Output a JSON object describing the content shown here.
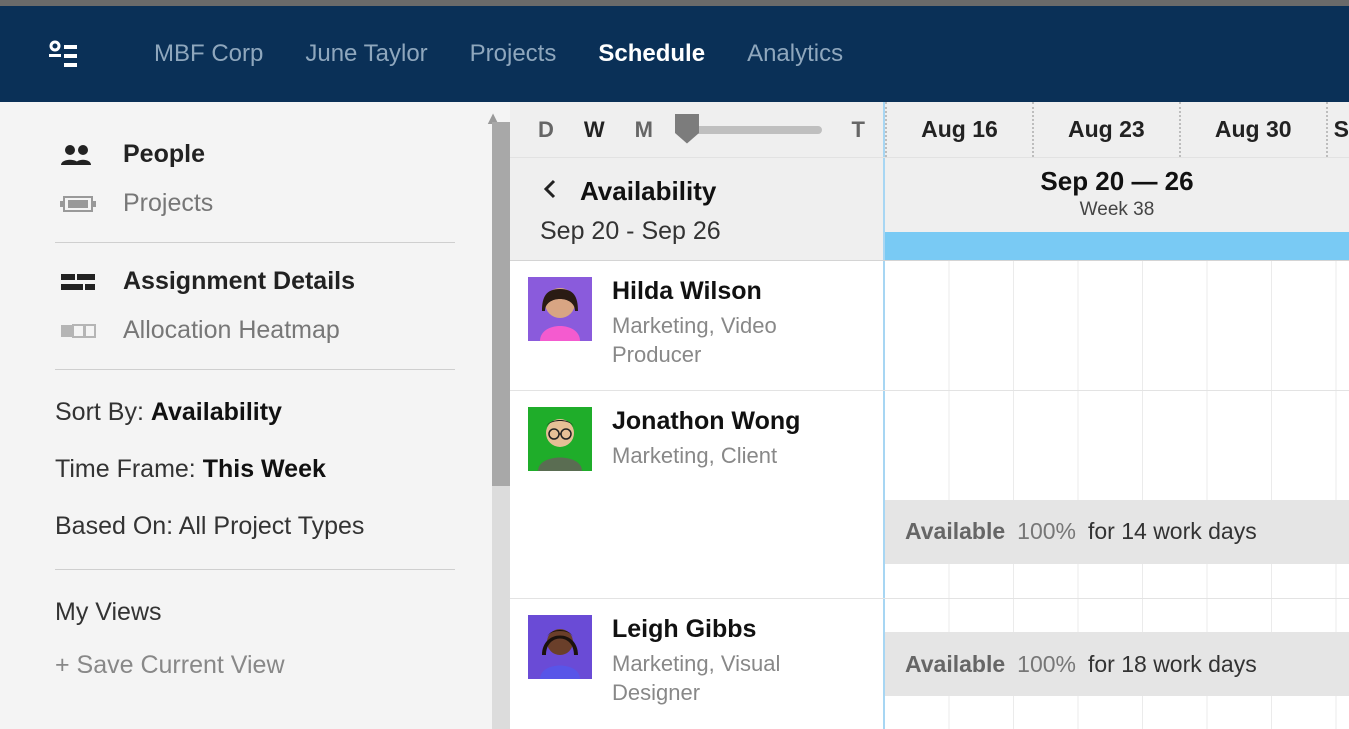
{
  "topnav": {
    "items": [
      {
        "label": "MBF Corp"
      },
      {
        "label": "June Taylor"
      },
      {
        "label": "Projects"
      },
      {
        "label": "Schedule"
      },
      {
        "label": "Analytics"
      }
    ]
  },
  "sidebar": {
    "people": "People",
    "projects": "Projects",
    "assignment_details": "Assignment Details",
    "allocation_heatmap": "Allocation Heatmap",
    "sort_by": {
      "k": "Sort By: ",
      "v": "Availability"
    },
    "time_frame": {
      "k": "Time Frame: ",
      "v": "This Week"
    },
    "based_on": "Based On: All Project Types",
    "my_views": "My Views",
    "save_current_view": "+ Save Current View"
  },
  "timeline": {
    "scale": {
      "d": "D",
      "w": "W",
      "m": "M",
      "t": "T"
    },
    "columns": [
      "Aug 16",
      "Aug 23",
      "Aug 30",
      "S"
    ]
  },
  "availability_header": {
    "title": "Availability",
    "range": "Sep 20 - Sep 26",
    "week_title": "Sep 20 — 26",
    "week_sub": "Week 38"
  },
  "people": [
    {
      "name": "Hilda Wilson",
      "role": "Marketing, Video Producer",
      "avatar": {
        "bg": "#8a5bdc",
        "shirt": "#f45bcf",
        "skin": "#d8a583",
        "hair": "#2a1b14"
      },
      "availability": null
    },
    {
      "name": "Jonathon Wong",
      "role": "Marketing, Client",
      "avatar": {
        "bg": "#1fad2a",
        "shirt": "#5a6d52",
        "skin": "#e6bf96",
        "hair": "#1b1b1b"
      },
      "availability": {
        "label": "Available",
        "percent": "100%",
        "rest": "for 14 work days"
      }
    },
    {
      "name": "Leigh Gibbs",
      "role": "Marketing, Visual Designer",
      "avatar": {
        "bg": "#6a4bd6",
        "shirt": "#5855e8",
        "skin": "#6a3f2a",
        "hair": "#1b120d"
      },
      "availability": {
        "label": "Available",
        "percent": "100%",
        "rest": "for 18 work days"
      }
    }
  ]
}
